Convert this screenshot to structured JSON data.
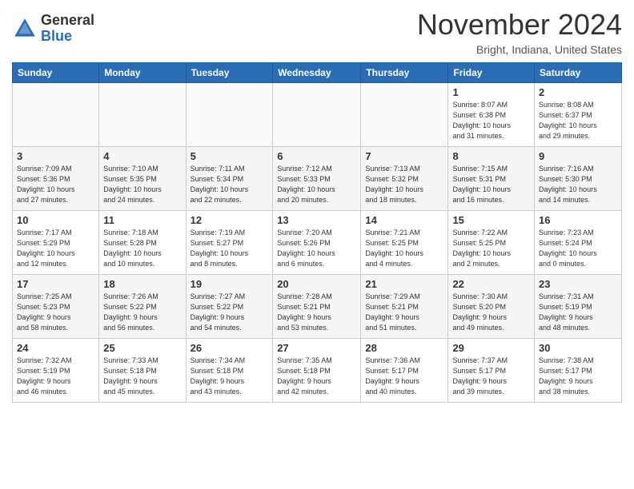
{
  "logo": {
    "general": "General",
    "blue": "Blue"
  },
  "header": {
    "month": "November 2024",
    "location": "Bright, Indiana, United States"
  },
  "weekdays": [
    "Sunday",
    "Monday",
    "Tuesday",
    "Wednesday",
    "Thursday",
    "Friday",
    "Saturday"
  ],
  "weeks": [
    [
      {
        "day": "",
        "info": ""
      },
      {
        "day": "",
        "info": ""
      },
      {
        "day": "",
        "info": ""
      },
      {
        "day": "",
        "info": ""
      },
      {
        "day": "",
        "info": ""
      },
      {
        "day": "1",
        "info": "Sunrise: 8:07 AM\nSunset: 6:38 PM\nDaylight: 10 hours\nand 31 minutes."
      },
      {
        "day": "2",
        "info": "Sunrise: 8:08 AM\nSunset: 6:37 PM\nDaylight: 10 hours\nand 29 minutes."
      }
    ],
    [
      {
        "day": "3",
        "info": "Sunrise: 7:09 AM\nSunset: 5:36 PM\nDaylight: 10 hours\nand 27 minutes."
      },
      {
        "day": "4",
        "info": "Sunrise: 7:10 AM\nSunset: 5:35 PM\nDaylight: 10 hours\nand 24 minutes."
      },
      {
        "day": "5",
        "info": "Sunrise: 7:11 AM\nSunset: 5:34 PM\nDaylight: 10 hours\nand 22 minutes."
      },
      {
        "day": "6",
        "info": "Sunrise: 7:12 AM\nSunset: 5:33 PM\nDaylight: 10 hours\nand 20 minutes."
      },
      {
        "day": "7",
        "info": "Sunrise: 7:13 AM\nSunset: 5:32 PM\nDaylight: 10 hours\nand 18 minutes."
      },
      {
        "day": "8",
        "info": "Sunrise: 7:15 AM\nSunset: 5:31 PM\nDaylight: 10 hours\nand 16 minutes."
      },
      {
        "day": "9",
        "info": "Sunrise: 7:16 AM\nSunset: 5:30 PM\nDaylight: 10 hours\nand 14 minutes."
      }
    ],
    [
      {
        "day": "10",
        "info": "Sunrise: 7:17 AM\nSunset: 5:29 PM\nDaylight: 10 hours\nand 12 minutes."
      },
      {
        "day": "11",
        "info": "Sunrise: 7:18 AM\nSunset: 5:28 PM\nDaylight: 10 hours\nand 10 minutes."
      },
      {
        "day": "12",
        "info": "Sunrise: 7:19 AM\nSunset: 5:27 PM\nDaylight: 10 hours\nand 8 minutes."
      },
      {
        "day": "13",
        "info": "Sunrise: 7:20 AM\nSunset: 5:26 PM\nDaylight: 10 hours\nand 6 minutes."
      },
      {
        "day": "14",
        "info": "Sunrise: 7:21 AM\nSunset: 5:25 PM\nDaylight: 10 hours\nand 4 minutes."
      },
      {
        "day": "15",
        "info": "Sunrise: 7:22 AM\nSunset: 5:25 PM\nDaylight: 10 hours\nand 2 minutes."
      },
      {
        "day": "16",
        "info": "Sunrise: 7:23 AM\nSunset: 5:24 PM\nDaylight: 10 hours\nand 0 minutes."
      }
    ],
    [
      {
        "day": "17",
        "info": "Sunrise: 7:25 AM\nSunset: 5:23 PM\nDaylight: 9 hours\nand 58 minutes."
      },
      {
        "day": "18",
        "info": "Sunrise: 7:26 AM\nSunset: 5:22 PM\nDaylight: 9 hours\nand 56 minutes."
      },
      {
        "day": "19",
        "info": "Sunrise: 7:27 AM\nSunset: 5:22 PM\nDaylight: 9 hours\nand 54 minutes."
      },
      {
        "day": "20",
        "info": "Sunrise: 7:28 AM\nSunset: 5:21 PM\nDaylight: 9 hours\nand 53 minutes."
      },
      {
        "day": "21",
        "info": "Sunrise: 7:29 AM\nSunset: 5:21 PM\nDaylight: 9 hours\nand 51 minutes."
      },
      {
        "day": "22",
        "info": "Sunrise: 7:30 AM\nSunset: 5:20 PM\nDaylight: 9 hours\nand 49 minutes."
      },
      {
        "day": "23",
        "info": "Sunrise: 7:31 AM\nSunset: 5:19 PM\nDaylight: 9 hours\nand 48 minutes."
      }
    ],
    [
      {
        "day": "24",
        "info": "Sunrise: 7:32 AM\nSunset: 5:19 PM\nDaylight: 9 hours\nand 46 minutes."
      },
      {
        "day": "25",
        "info": "Sunrise: 7:33 AM\nSunset: 5:18 PM\nDaylight: 9 hours\nand 45 minutes."
      },
      {
        "day": "26",
        "info": "Sunrise: 7:34 AM\nSunset: 5:18 PM\nDaylight: 9 hours\nand 43 minutes."
      },
      {
        "day": "27",
        "info": "Sunrise: 7:35 AM\nSunset: 5:18 PM\nDaylight: 9 hours\nand 42 minutes."
      },
      {
        "day": "28",
        "info": "Sunrise: 7:36 AM\nSunset: 5:17 PM\nDaylight: 9 hours\nand 40 minutes."
      },
      {
        "day": "29",
        "info": "Sunrise: 7:37 AM\nSunset: 5:17 PM\nDaylight: 9 hours\nand 39 minutes."
      },
      {
        "day": "30",
        "info": "Sunrise: 7:38 AM\nSunset: 5:17 PM\nDaylight: 9 hours\nand 38 minutes."
      }
    ]
  ]
}
